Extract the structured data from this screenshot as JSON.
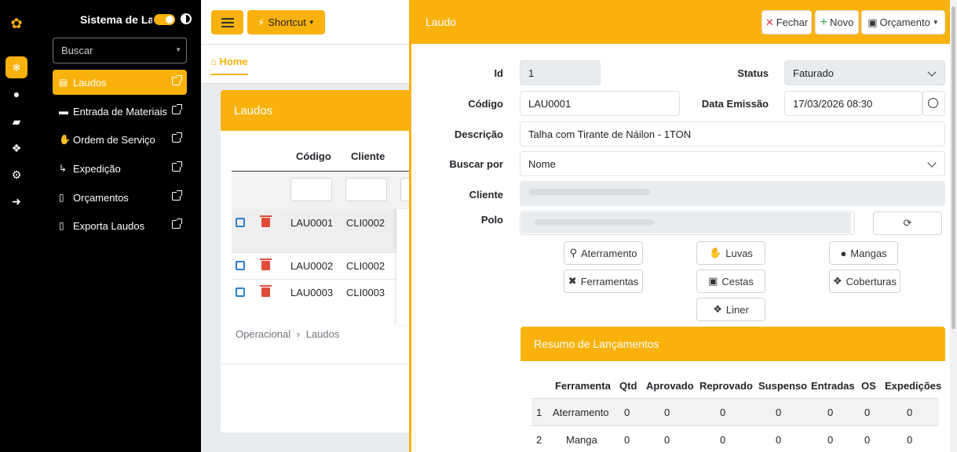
{
  "sidebar": {
    "title": "Sistema de Laudos",
    "search_placeholder": "Buscar",
    "items": [
      {
        "label": "Laudos"
      },
      {
        "label": "Entrada de Materiais"
      },
      {
        "label": "Ordem de Serviço"
      },
      {
        "label": "Expedição"
      },
      {
        "label": "Orçamentos"
      },
      {
        "label": "Exporta Laudos"
      }
    ]
  },
  "topbar": {
    "shortcut_label": "Shortcut"
  },
  "home": {
    "label": "Home"
  },
  "list": {
    "title": "Laudos",
    "columns": [
      "Código",
      "Cliente"
    ],
    "rows": [
      {
        "codigo": "LAU0001",
        "cliente": "CLI0002"
      },
      {
        "codigo": "LAU0002",
        "cliente": "CLI0002"
      },
      {
        "codigo": "LAU0003",
        "cliente": "CLI0003"
      }
    ],
    "breadcrumb": [
      "Operacional",
      "Laudos"
    ]
  },
  "panel": {
    "title": "Laudo",
    "buttons": {
      "fechar": "Fechar",
      "novo": "Novo",
      "orcamento": "Orçamento"
    },
    "labels": {
      "id": "Id",
      "status": "Status",
      "codigo": "Código",
      "data": "Data Emissão",
      "descricao": "Descrição",
      "buscar": "Buscar por",
      "cliente": "Cliente",
      "polo": "Polo"
    },
    "values": {
      "id": "1",
      "status": "Faturado",
      "codigo": "LAU0001",
      "data": "17/03/2026 08:30",
      "descricao": "Talha com Tirante de Náilon - 1TON",
      "buscar": "Nome"
    },
    "tools": {
      "aterramento": "Aterramento",
      "luvas": "Luvas",
      "mangas": "Mangas",
      "ferramentas": "Ferramentas",
      "cestas": "Cestas",
      "coberturas": "Coberturas",
      "liner": "Liner"
    }
  },
  "resumo": {
    "title": "Resumo de Lançamentos",
    "columns": [
      "Ferramenta",
      "Qtd",
      "Aprovado",
      "Reprovado",
      "Suspenso",
      "Entradas",
      "OS",
      "Expedições"
    ],
    "rows": [
      {
        "n": "1",
        "ferramenta": "Aterramento",
        "qtd": "0",
        "aprovado": "0",
        "reprovado": "0",
        "suspenso": "0",
        "entradas": "0",
        "os": "0",
        "expedicoes": "0"
      },
      {
        "n": "2",
        "ferramenta": "Manga",
        "qtd": "0",
        "aprovado": "0",
        "reprovado": "0",
        "suspenso": "0",
        "entradas": "0",
        "os": "0",
        "expedicoes": "0"
      }
    ]
  }
}
